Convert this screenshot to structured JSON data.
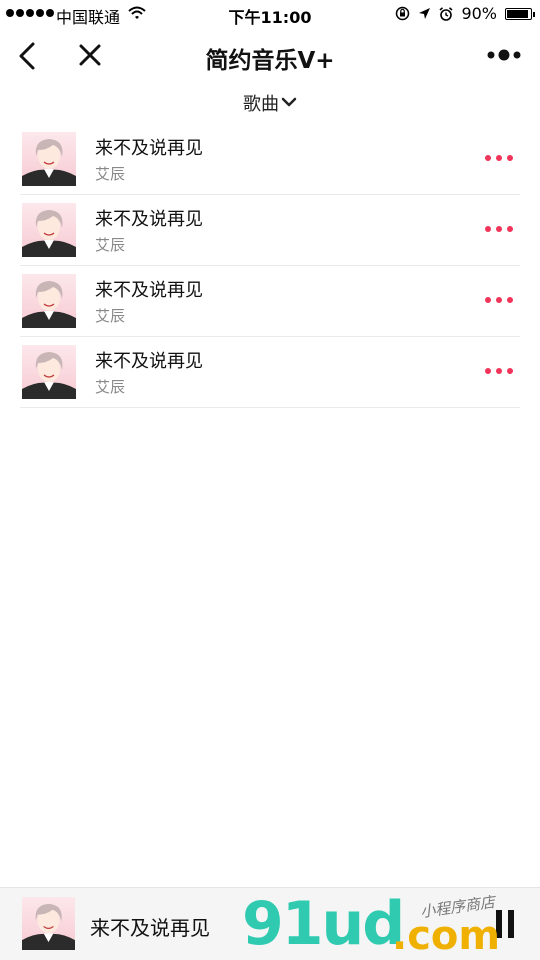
{
  "status_bar": {
    "carrier": "中国联通",
    "time": "下午11:00",
    "battery_text": "90%",
    "battery_level": 0.9,
    "icons": [
      "signal-dots",
      "wifi-icon",
      "orientation-lock-icon",
      "location-arrow-icon",
      "alarm-icon",
      "battery-icon"
    ]
  },
  "nav": {
    "title": "简约音乐V+",
    "back_icon": "chevron-left-icon",
    "close_icon": "close-icon",
    "more_icon": "capsule-more-icon"
  },
  "filter": {
    "label": "歌曲",
    "icon": "chevron-down-icon"
  },
  "songs": [
    {
      "title": "来不及说再见",
      "artist": "艾辰"
    },
    {
      "title": "来不及说再见",
      "artist": "艾辰"
    },
    {
      "title": "来不及说再见",
      "artist": "艾辰"
    },
    {
      "title": "来不及说再见",
      "artist": "艾辰"
    }
  ],
  "player": {
    "title": "来不及说再见",
    "state_icon": "pause-icon"
  },
  "watermark": {
    "logo": "91ud",
    "domain": ".com",
    "slogan": "小程序商店"
  },
  "colors": {
    "accent": "#f0345a",
    "background": "#ffffff",
    "player_background": "#f5f5f5",
    "watermark_green": "#2fcab0",
    "watermark_yellow": "#f0b000"
  }
}
